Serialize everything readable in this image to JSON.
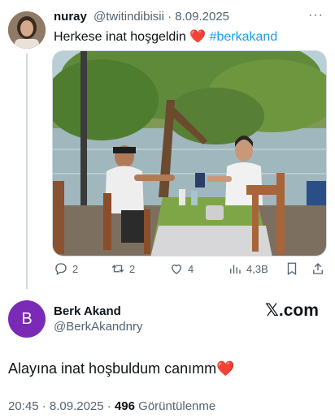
{
  "quoted_tweet": {
    "author_name": "nuray",
    "author_handle": "@twitindibisii",
    "separator": "·",
    "date": "8.09.2025",
    "more_label": "···",
    "text": "Herkese inat hoşgeldin",
    "emoji": "❤️",
    "hashtag": "#berkakand",
    "actions": {
      "replies": "2",
      "retweets": "2",
      "likes": "4",
      "views": "4,3B"
    }
  },
  "main_tweet": {
    "avatar_letter": "B",
    "author_name": "Berk Akand",
    "author_handle": "@BerkAkandnry",
    "text": "Alayına inat hoşbuldum canımm",
    "emoji": "❤️",
    "time": "20:45",
    "separator": "·",
    "date": "8.09.2025",
    "views_count": "496",
    "views_label": "Görüntülenme"
  },
  "brand": {
    "logo_text": "𝕏.com"
  },
  "colors": {
    "link": "#1d9bf0",
    "muted": "#536471",
    "avatar_b": "#7b2ab8",
    "heart": "#e0245e"
  }
}
